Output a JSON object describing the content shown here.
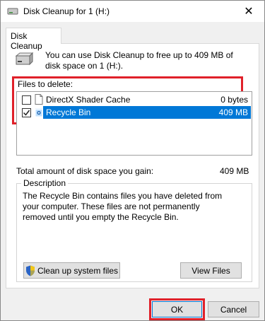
{
  "window": {
    "title": "Disk Cleanup for 1 (H:)",
    "close_glyph": "✕"
  },
  "tab": {
    "label": "Disk Cleanup"
  },
  "intro": {
    "text": "You can use Disk Cleanup to free up to 409 MB of disk space on 1 (H:)."
  },
  "files": {
    "label": "Files to delete:",
    "items": [
      {
        "name": "DirectX Shader Cache",
        "size": "0 bytes",
        "checked": false,
        "selected": false,
        "icon": "file-icon"
      },
      {
        "name": "Recycle Bin",
        "size": "409 MB",
        "checked": true,
        "selected": true,
        "icon": "recycle-bin-icon"
      }
    ]
  },
  "total": {
    "label": "Total amount of disk space you gain:",
    "value": "409 MB"
  },
  "description": {
    "title": "Description",
    "text": "The Recycle Bin contains files you have deleted from your computer. These files are not permanently removed until you empty the Recycle Bin."
  },
  "buttons": {
    "cleanup_system": "Clean up system files",
    "view_files": "View Files",
    "ok": "OK",
    "cancel": "Cancel"
  },
  "colors": {
    "selection": "#0078d7",
    "highlight_box": "#e0212a"
  }
}
